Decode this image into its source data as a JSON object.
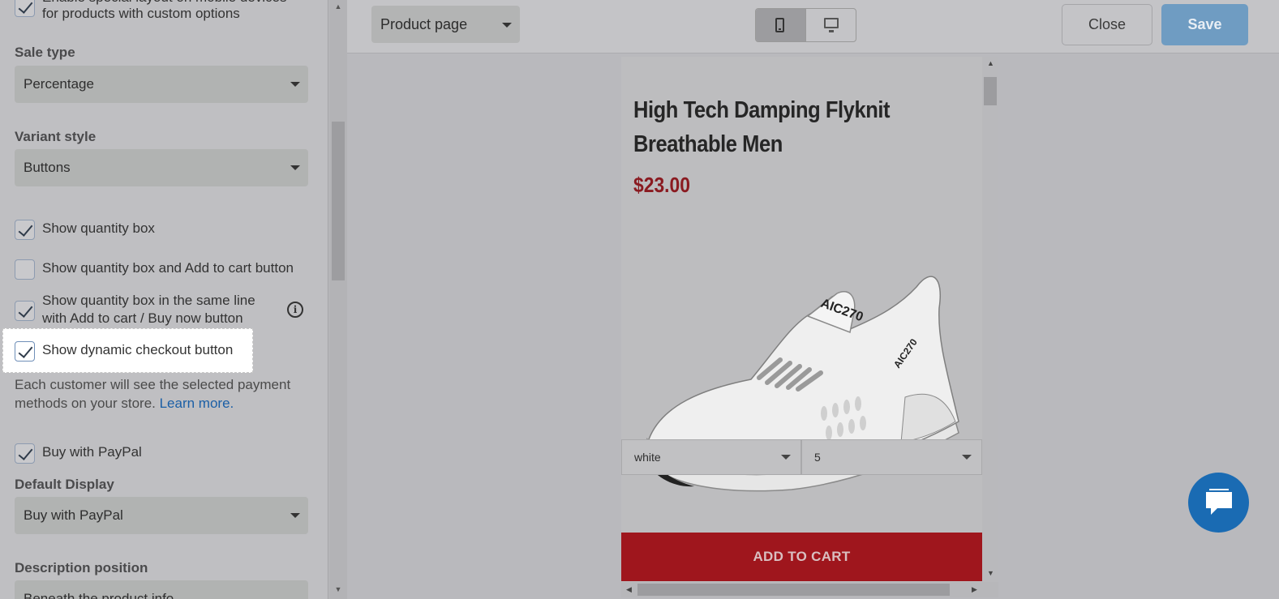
{
  "sidebar": {
    "top_checkbox": {
      "line1": "Enable special layout on mobile devices",
      "line2": "for products with custom options",
      "checked": true
    },
    "sale_type": {
      "label": "Sale type",
      "value": "Percentage"
    },
    "variant_style": {
      "label": "Variant style",
      "value": "Buttons"
    },
    "checkboxes": [
      {
        "text": "Show quantity box",
        "checked": true
      },
      {
        "text": "Show quantity box and Add to cart button",
        "checked": false
      },
      {
        "line1": "Show quantity box in the same line",
        "line2": "with Add to cart / Buy now button",
        "checked": true
      },
      {
        "text": "Show dynamic checkout button",
        "checked": true
      }
    ],
    "description": {
      "text": "Each customer will see the selected payment methods on your store. ",
      "link": "Learn more."
    },
    "paypal_checkbox": {
      "text": "Buy with PayPal",
      "checked": true
    },
    "default_display": {
      "label": "Default Display",
      "value": "Buy with PayPal"
    },
    "description_position": {
      "label": "Description position",
      "value": "Beneath the product info"
    }
  },
  "toolbar": {
    "page_select": "Product page",
    "close_label": "Close",
    "save_label": "Save"
  },
  "preview": {
    "product_title": "High Tech Damping Flyknit Breathable Men",
    "price": "$23.00",
    "shoe_text": "AIC270",
    "variants": [
      "white",
      "5"
    ],
    "add_to_cart": "ADD TO CART"
  },
  "colors": {
    "save": "#6f9cc2",
    "add_to_cart": "#9f161d",
    "price": "#8a1a20",
    "chat": "#1a6bb3",
    "link": "#1b5fa6"
  }
}
